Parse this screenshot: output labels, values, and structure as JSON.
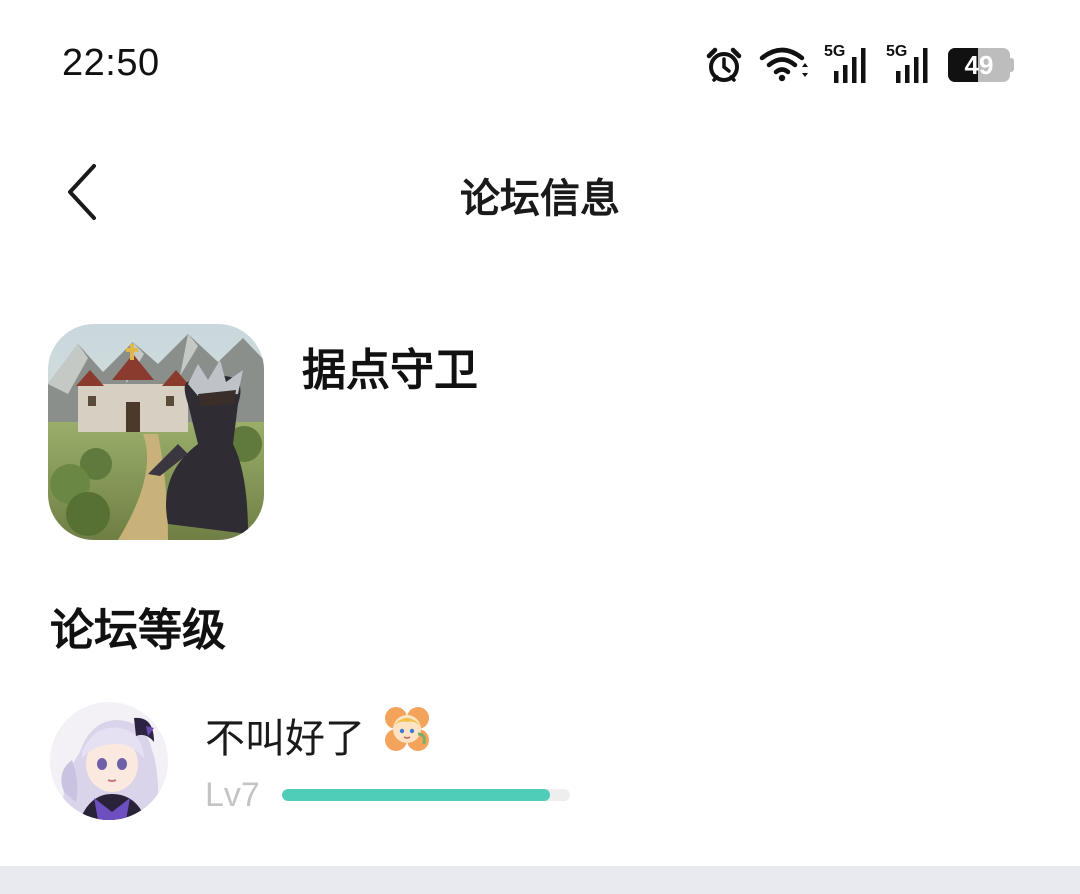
{
  "status_bar": {
    "time": "22:50",
    "battery": "49",
    "battery_level": 0.49,
    "network_1": "5G",
    "network_2": "5G",
    "icons": [
      "alarm-icon",
      "wifi-icon",
      "signal-5g-icon",
      "signal-5g-icon",
      "battery-icon"
    ]
  },
  "header": {
    "title": "论坛信息",
    "back_icon": "chevron-left-icon"
  },
  "forum": {
    "name": "据点守卫"
  },
  "level_section": {
    "title": "论坛等级",
    "user_name": "不叫好了",
    "level": "Lv7",
    "progress": 0.93,
    "progress_color": "#4fcdb9"
  }
}
